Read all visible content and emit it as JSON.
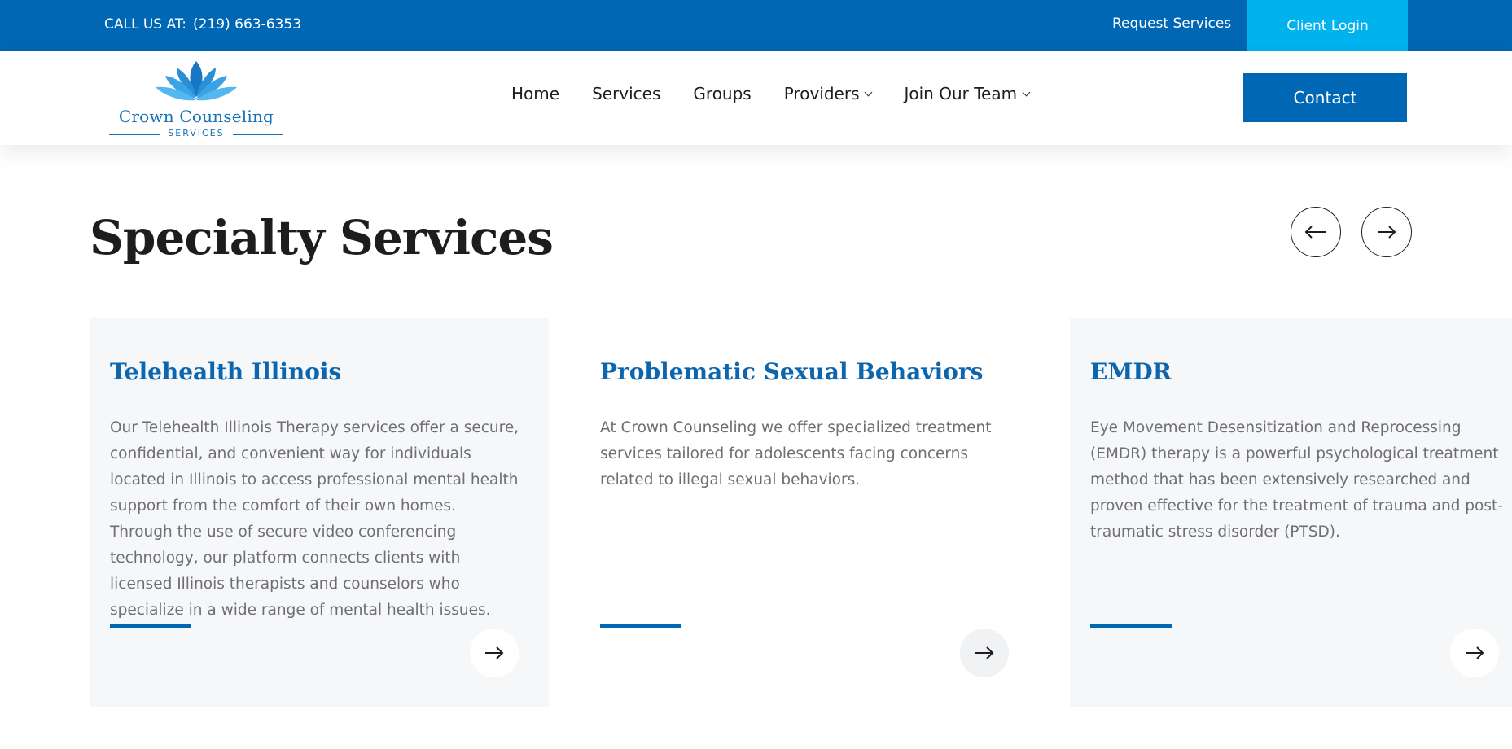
{
  "topbar": {
    "call_label": "CALL US AT:",
    "phone": "(219) 663-6353",
    "request_services": "Request Services",
    "client_login": "Client Login"
  },
  "header": {
    "logo_name": "Crown Counseling",
    "logo_sub": "SERVICES",
    "nav": [
      {
        "label": "Home",
        "icon": null
      },
      {
        "label": "Services",
        "icon": null
      },
      {
        "label": "Groups",
        "icon": null
      },
      {
        "label": "Providers",
        "icon": "chevron-down-icon"
      },
      {
        "label": "Join Our Team",
        "icon": "chevron-down-icon"
      }
    ],
    "contact": "Contact"
  },
  "section": {
    "title": "Specialty Services",
    "prev_icon": "arrow-left-icon",
    "next_icon": "arrow-right-icon"
  },
  "cards": [
    {
      "title": "Telehealth Illinois",
      "text": "Our Telehealth Illinois Therapy services offer a secure, confidential, and convenient way for individuals located in Illinois to access professional mental health support from the comfort of their own homes. Through the use of secure video conferencing technology, our platform connects clients with licensed Illinois therapists and counselors who specialize in a wide range of mental health issues.",
      "icon": "arrow-right-icon"
    },
    {
      "title": "Problematic Sexual Behaviors",
      "text": "At Crown Counseling we offer specialized treatment services tailored for adolescents facing concerns related to illegal sexual behaviors.",
      "icon": "arrow-right-icon"
    },
    {
      "title": "EMDR",
      "text": "Eye Movement Desensitization and Reprocessing (EMDR) therapy is a powerful psychological treatment method that has been extensively researched and proven effective for the treatment of trauma and post-traumatic stress disorder (PTSD).",
      "icon": "arrow-right-icon"
    }
  ],
  "colors": {
    "brand_blue": "#0067b4",
    "login_cyan": "#00b3ee",
    "card_bg": "#f5f7f9",
    "card_title": "#0d66ad"
  }
}
